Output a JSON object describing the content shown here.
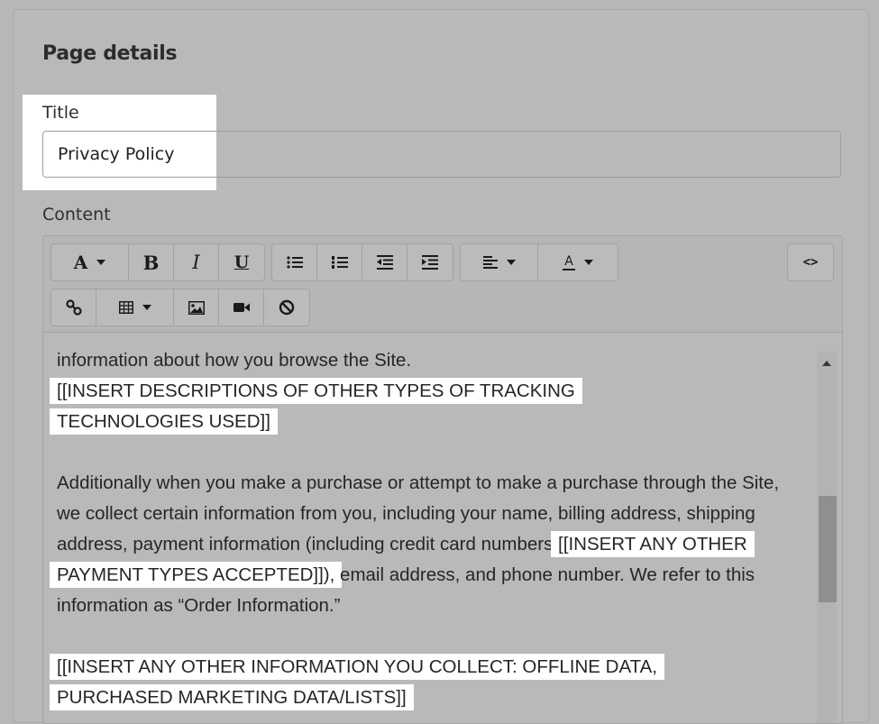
{
  "section": {
    "title": "Page details"
  },
  "title_field": {
    "label": "Title",
    "value": "Privacy Policy"
  },
  "content_field": {
    "label": "Content"
  },
  "toolbar": {
    "font_label": "A",
    "bold_label": "B",
    "italic_label": "I",
    "underline_label": "U",
    "text_color_label": "A",
    "code_label": "<>"
  },
  "content": {
    "line1": "information about how you browse the Site.",
    "highlight1": "[[INSERT DESCRIPTIONS OF OTHER TYPES OF TRACKING TECHNOLOGIES USED]]",
    "para2_before": "Additionally when you make a purchase or attempt to make a purchase through the Site, we collect certain information from you, including your name, billing address, shipping address, payment information (including credit card numbers ",
    "highlight2": "[[INSERT ANY OTHER PAYMENT TYPES ACCEPTED]]),",
    "para2_after": " email address, and phone number.  We refer to this information as “Order Information.”",
    "highlight3": "[[INSERT ANY OTHER INFORMATION YOU COLLECT:  OFFLINE DATA, PURCHASED MARKETING DATA/LISTS]]"
  },
  "icons": {
    "font": "font-icon",
    "bullets": "bulleted-list-icon",
    "numbers": "numbered-list-icon",
    "outdent": "outdent-icon",
    "indent": "indent-icon",
    "align": "align-left-icon",
    "color": "text-color-icon",
    "link": "link-icon",
    "table": "table-icon",
    "image": "image-icon",
    "video": "video-icon",
    "clear": "clear-formatting-icon"
  },
  "colors": {
    "highlight": "#ffffff",
    "overlay": "#b9b9b9"
  }
}
